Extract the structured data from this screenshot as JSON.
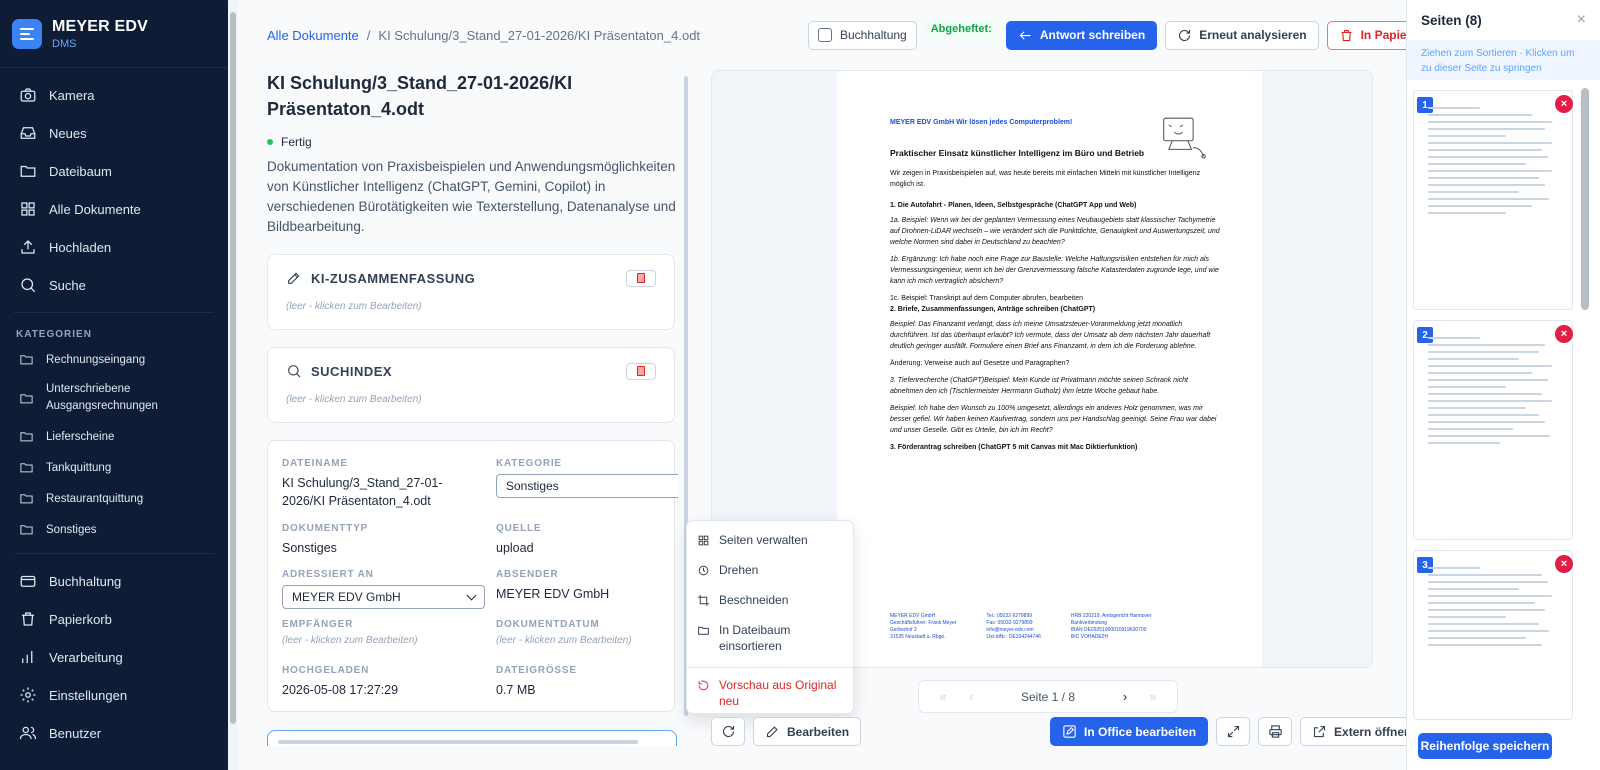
{
  "brand": {
    "name": "MEYER EDV",
    "sub": "DMS"
  },
  "nav": [
    {
      "label": "Kamera",
      "icon": "camera-icon"
    },
    {
      "label": "Neues",
      "icon": "inbox-icon"
    },
    {
      "label": "Dateibaum",
      "icon": "folder-icon"
    },
    {
      "label": "Alle Dokumente",
      "icon": "grid-icon"
    },
    {
      "label": "Hochladen",
      "icon": "upload-icon"
    },
    {
      "label": "Suche",
      "icon": "search-icon"
    }
  ],
  "categories_label": "KATEGORIEN",
  "categories": [
    "Rechnungseingang",
    "Unterschriebene Ausgangsrechnungen",
    "Lieferscheine",
    "Tankquittung",
    "Restaurantquittung",
    "Sonstiges"
  ],
  "nav_bottom": [
    {
      "label": "Buchhaltung",
      "icon": "card-icon"
    },
    {
      "label": "Papierkorb",
      "icon": "trash-icon"
    },
    {
      "label": "Verarbeitung",
      "icon": "chart-icon"
    },
    {
      "label": "Einstellungen",
      "icon": "gear-icon"
    },
    {
      "label": "Benutzer",
      "icon": "users-icon"
    }
  ],
  "breadcrumb": {
    "root": "Alle Dokumente",
    "sep": "/",
    "current": "KI Schulung/3_Stand_27-01-2026/KI Präsentaton_4.odt"
  },
  "toolbar": {
    "buchhaltung": "Buchhaltung",
    "pinned": "Abgeheftet:",
    "reply": "Antwort schreiben",
    "reanalyze": "Erneut analysieren",
    "trash": "In Papierkorb"
  },
  "doc": {
    "title": "KI Schulung/3_Stand_27-01-2026/KI Präsentaton_4.odt",
    "status": "Fertig",
    "summary": "Dokumentation von Praxisbeispielen und Anwendungsmöglichkeiten von Künstlicher Intelligenz (ChatGPT, Gemini, Copilot) in verschiedenen Bürotätigkeiten wie Texterstellung, Datenanalyse und Bildbearbeitung."
  },
  "cards": {
    "ki": {
      "title": "KI-ZUSAMMENFASSUNG",
      "empty": "(leer - klicken zum Bearbeiten)"
    },
    "index": {
      "title": "SUCHINDEX",
      "empty": "(leer - klicken zum Bearbeiten)"
    }
  },
  "meta": {
    "dateiname_label": "DATEINAME",
    "dateiname": "KI Schulung/3_Stand_27-01-2026/KI Präsentaton_4.odt",
    "kategorie_label": "KATEGORIE",
    "kategorie": "Sonstiges",
    "doktyp_label": "DOKUMENTTYP",
    "doktyp": "Sonstiges",
    "quelle_label": "QUELLE",
    "quelle": "upload",
    "adressiert_label": "ADRESSIERT AN",
    "adressiert": "MEYER EDV GmbH",
    "absender_label": "ABSENDER",
    "absender": "MEYER EDV GmbH",
    "empfaenger_label": "EMPFÄNGER",
    "empfaenger": "(leer - klicken zum Bearbeiten)",
    "datum_label": "DOKUMENTDATUM",
    "datum": "(leer - klicken zum Bearbeiten)",
    "hochgeladen_label": "HOCHGELADEN",
    "hochgeladen": "2026-05-08 17:27:29",
    "groesse_label": "DATEIGRÖSSE",
    "groesse": "0.7 MB"
  },
  "preview": {
    "head": "MEYER EDV GmbH  Wir lösen jedes Computerproblem!",
    "title": "Praktischer Einsatz künstlicher Intelligenz im Büro und Betrieb",
    "intro": "Wir zeigen in Praxisbeispielen auf, was heute bereits mit einfachen Mitteln mit künstlicher Intelligenz möglich ist.",
    "h1": "1. Die Autofahrt - Planen, Ideen, Selbstgespräche (ChatGPT App und Web)",
    "p1": "1a. Beispiel: Wenn wir bei der geplanten Vermessung eines Neubaugebiets statt klassischer Tachymetrie auf Drohnen-LiDAR wechseln – wie verändert sich die Punktdichte, Genauigkeit und Auswertungszeit, und welche Normen sind dabei in Deutschland zu beachten?",
    "p2": "1b. Ergänzung: Ich habe noch eine Frage zur Baustelle: Welche Haftungsrisiken entstehen für mich als Vermessungsingenieur, wenn ich bei der Grenzvermessung falsche Katasterdaten zugrunde lege, und wie kann ich mich vertraglich absichern?",
    "p3": "1c. Beispiel:   Transkript auf dem Computer abrufen, bearbeiten",
    "h2": "2. Briefe, Zusammenfassungen, Anträge schreiben (ChatGPT)",
    "p4": "Beispiel: Das Finanzamt verlangt, dass ich meine Umsatzsteuer-Voranmeldung jetzt monatlich durchführen. Ist das überhaupt erlaubt? Ich vermute, dass der Umsatz ab dem nächsten Jahr dauerhaft deutlich geringer ausfällt. Formuliere einen Brief ans Finanzamt, in dem ich die Forderung ablehne.",
    "p5": "Änderung: Verweise auch auf Gesetze und Paragraphen?",
    "h3": "3. Tiefenrecherche (ChatGPT)Beispiel: Mein Kunde ist Privatmann möchte seinen Schrank nicht abnehmen den ich (Tischlermeister Herrmann Gutholz) ihm letzte Woche gebaut habe.",
    "p6": "Beispiel: Ich habe den Wunsch zu 100% umgesetzt, allerdings ein anderes Holz genommen, was mir besser gefiel. Wir haben keinen Kaufvertrag, sondern uns per Handschlag geeinigt. Seine Frau war dabei und unser Geselle. Gibt es Urteile, bin ich im Recht?",
    "h4": "3. Förderantrag schreiben (ChatGPT 5 mit Canvas mit Mac Diktierfunktion)",
    "f1": "MEYER EDV GmbH\nGeschäftsführer: Frank Meyer\nGerberhof 3\n31535 Neustadt a. Rbge.",
    "f2": "Tel.: 05032-9279899\nFax: 05032-9279899\ninfo@meyer-edv.com\nUst-IdNr.: DE334244746",
    "f3": "HRB 220219, Amtsgericht Hannover\nBankverbindung\nIBAN  DE09251900010919630700\nBIC   VOHADE2H"
  },
  "pager": {
    "first": "«",
    "prev": "‹",
    "label": "Seite 1 / 8",
    "next": "›",
    "last": "»"
  },
  "context_menu": [
    "Seiten verwalten",
    "Drehen",
    "Beschneiden",
    "In Dateibaum einsortieren",
    "Vorschau aus Original neu"
  ],
  "bottom": {
    "edit": "Bearbeiten",
    "office": "In Office bearbeiten",
    "external": "Extern öffnen"
  },
  "pages_panel": {
    "title": "Seiten (8)",
    "close": "×",
    "hint": "Ziehen zum Sortieren · Klicken um zu dieser Seite zu springen",
    "thumbs": [
      "1",
      "2",
      "3"
    ],
    "save": "Reihenfolge speichern"
  },
  "colors": {
    "sidebar": "#0f1c36",
    "accent": "#2563eb",
    "danger": "#dc2626",
    "success": "#16a34a"
  }
}
